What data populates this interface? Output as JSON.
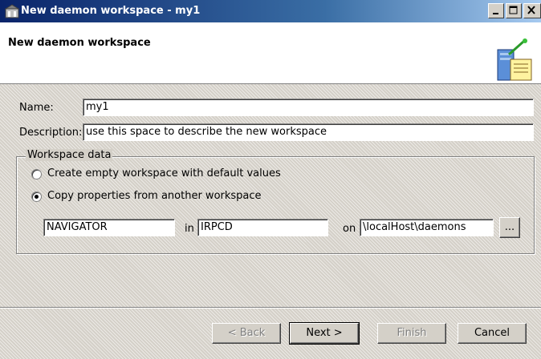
{
  "window": {
    "title": "New daemon workspace - my1"
  },
  "header": {
    "title": "New daemon workspace"
  },
  "form": {
    "name_label": "Name:",
    "name_value": "my1",
    "description_label": "Description:",
    "description_value": "use this space to describe the new workspace"
  },
  "workspace_data": {
    "group_label": "Workspace data",
    "option_empty": "Create empty workspace with default values",
    "option_copy": "Copy properties from another workspace",
    "selected": "copy",
    "source_workspace": "NAVIGATOR",
    "in_label": "in",
    "source_daemon": "IRPCD",
    "on_label": "on",
    "source_host": "\\localHost\\daemons",
    "browse_label": "..."
  },
  "buttons": {
    "back": "< Back",
    "next": "Next >",
    "finish": "Finish",
    "cancel": "Cancel"
  }
}
